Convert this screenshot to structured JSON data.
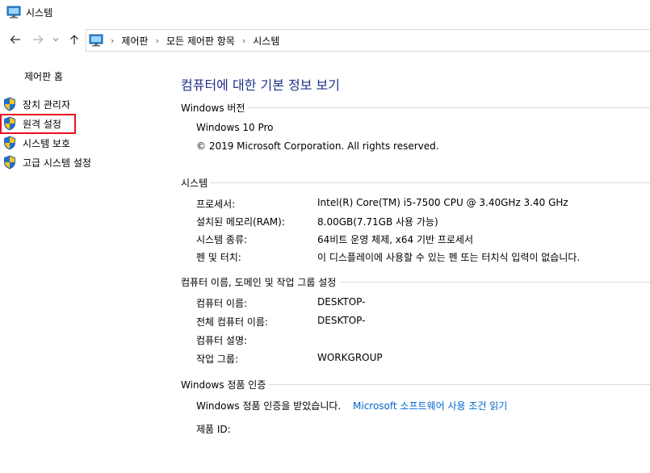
{
  "window": {
    "title": "시스템",
    "icon": "computer-monitor-icon"
  },
  "nav": {
    "back_icon": "arrow-left-icon",
    "forward_icon": "arrow-right-icon",
    "recent_icon": "chevron-down-icon",
    "up_icon": "arrow-up-icon",
    "breadcrumb": [
      "제어판",
      "모든 제어판 항목",
      "시스템"
    ]
  },
  "sidebar": {
    "home_label": "제어판 홈",
    "items": [
      {
        "label": "장치 관리자",
        "icon": "uac-shield-icon"
      },
      {
        "label": "원격 설정",
        "icon": "uac-shield-icon"
      },
      {
        "label": "시스템 보호",
        "icon": "uac-shield-icon"
      },
      {
        "label": "고급 시스템 설정",
        "icon": "uac-shield-icon"
      }
    ],
    "highlight_color": "#e81123"
  },
  "main": {
    "title": "컴퓨터에 대한 기본 정보 보기",
    "title_color": "#1e3287",
    "windows_edition": {
      "header": "Windows 버전",
      "edition": "Windows 10 Pro",
      "copyright": "© 2019 Microsoft Corporation. All rights reserved."
    },
    "system": {
      "header": "시스템",
      "rows": [
        {
          "label": "프로세서:",
          "value": "Intel(R) Core(TM) i5-7500 CPU @ 3.40GHz   3.40 GHz"
        },
        {
          "label": "설치된 메모리(RAM):",
          "value": "8.00GB(7.71GB 사용 가능)"
        },
        {
          "label": "시스템 종류:",
          "value": "64비트 운영 체제, x64 기반 프로세서"
        },
        {
          "label": "펜 및 터치:",
          "value": "이 디스플레이에 사용할 수 있는 펜 또는 터치식 입력이 없습니다."
        }
      ]
    },
    "computer_name": {
      "header": "컴퓨터 이름, 도메인 및 작업 그룹 설정",
      "rows": [
        {
          "label": "컴퓨터 이름:",
          "value": "DESKTOP-"
        },
        {
          "label": "전체 컴퓨터 이름:",
          "value": "DESKTOP-"
        },
        {
          "label": "컴퓨터 설명:",
          "value": ""
        },
        {
          "label": "작업 그룹:",
          "value": "WORKGROUP"
        }
      ]
    },
    "activation": {
      "header": "Windows 정품 인증",
      "status": "Windows 정품 인증을 받았습니다.",
      "license_link": "Microsoft 소프트웨어 사용 조건 읽기",
      "product_id_label": "제품 ID:"
    },
    "link_color": "#0066cc"
  }
}
